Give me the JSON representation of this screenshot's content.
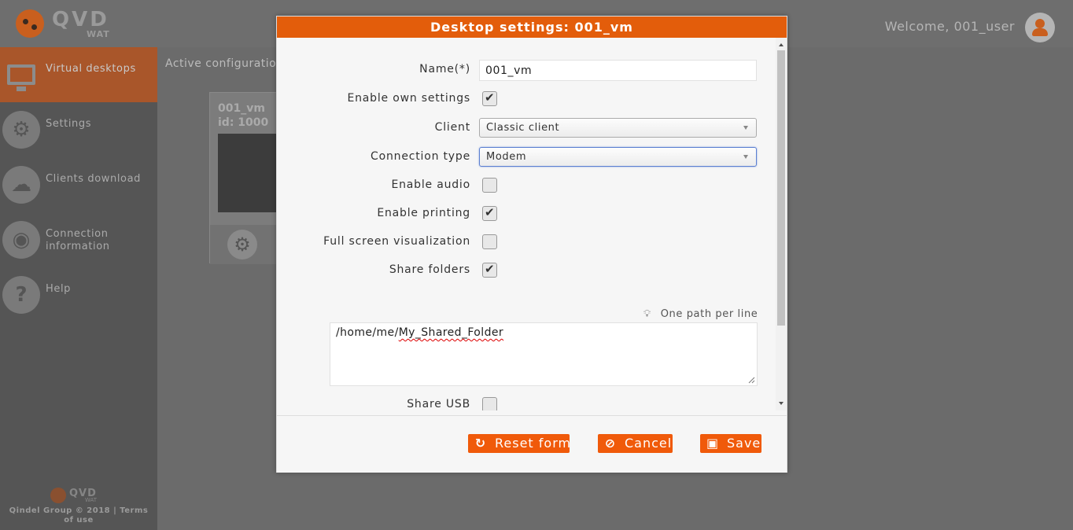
{
  "header": {
    "logo_brand": "QVD",
    "logo_sub": "WAT",
    "welcome": "Welcome, 001_user",
    "avatar_icon": "user-icon"
  },
  "sidebar": {
    "items": [
      {
        "label": "Virtual desktops",
        "icon": "monitor-icon",
        "active": true
      },
      {
        "label": "Settings",
        "icon": "gears-icon"
      },
      {
        "label": "Clients download",
        "icon": "cloud-download-icon"
      },
      {
        "label": "Connection information",
        "icon": "globe-icon"
      },
      {
        "label": "Help",
        "icon": "help-icon"
      }
    ],
    "footer_brand": "QVD",
    "footer_sub": "WAT",
    "copyright": "Qindel Group © 2018 | Terms of use"
  },
  "content": {
    "title": "Active configuration",
    "card_name": "001_vm",
    "card_id": "id: 1000"
  },
  "modal": {
    "title": "Desktop settings: 001_vm",
    "fields": {
      "name_label": "Name(*)",
      "name_value": "001_vm",
      "own_settings_label": "Enable own settings",
      "own_settings_checked": true,
      "client_label": "Client",
      "client_value": "Classic client",
      "connection_label": "Connection type",
      "connection_value": "Modem",
      "audio_label": "Enable audio",
      "audio_checked": false,
      "printing_label": "Enable printing",
      "printing_checked": true,
      "fullscreen_label": "Full screen visualization",
      "fullscreen_checked": false,
      "share_folders_label": "Share folders",
      "share_folders_checked": true,
      "path_hint": "One path per line",
      "folders_prefix": "/home/me/",
      "folders_word": "My_Shared_Folder",
      "share_usb_label": "Share USB",
      "share_usb_checked": false
    },
    "buttons": {
      "reset": "Reset form",
      "cancel": "Cancel",
      "save": "Save"
    }
  },
  "colors": {
    "accent": "#e35d0b",
    "button": "#f05a0a",
    "sidebar_active": "#a9562a"
  }
}
